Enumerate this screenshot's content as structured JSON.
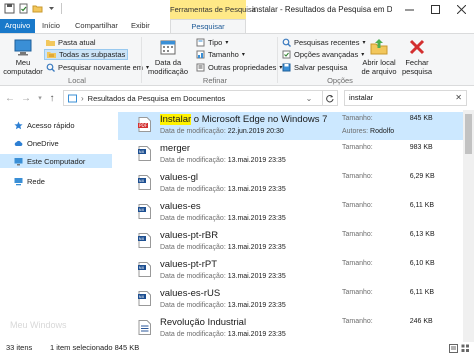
{
  "titlebar": {
    "context_tab_header": "Ferramentas de Pesquisa",
    "title": "instalar - Resultados da Pesquisa em Documentos",
    "qat_icons": [
      "save-icon",
      "properties-icon",
      "new-folder-icon",
      "customize-qat-icon"
    ]
  },
  "tabs": [
    {
      "label": "Arquivo"
    },
    {
      "label": "Início"
    },
    {
      "label": "Compartilhar"
    },
    {
      "label": "Exibir"
    },
    {
      "label": "Pesquisar"
    }
  ],
  "ribbon": {
    "local": {
      "my_computer": "Meu\ncomputador",
      "current_folder": "Pasta atual",
      "all_subfolders": "Todas as subpastas",
      "search_again": "Pesquisar novamente em",
      "group_label": "Local"
    },
    "refine": {
      "date_modified": "Data da\nmodificação",
      "kind": "Tipo",
      "size": "Tamanho",
      "other_properties": "Outras propriedades",
      "group_label": "Refinar"
    },
    "options": {
      "recent_searches": "Pesquisas recentes",
      "advanced_options": "Opções avançadas",
      "save_search": "Salvar pesquisa",
      "open_file_location": "Abrir local\nde arquivo",
      "close_search": "Fechar\npesquisa",
      "group_label": "Opções"
    }
  },
  "address": {
    "path": "Resultados da Pesquisa em Documentos",
    "search_value": "instalar"
  },
  "nav": [
    {
      "label": "Acesso rápido",
      "icon": "star-icon"
    },
    {
      "label": "OneDrive",
      "icon": "cloud-icon"
    },
    {
      "label": "Este Computador",
      "icon": "computer-icon"
    },
    {
      "label": "Rede",
      "icon": "network-icon"
    }
  ],
  "watermark": "Meu Windows",
  "files": [
    {
      "icon": "pdf-icon",
      "highlight": "Instalar",
      "rest": " o Microsoft Edge no Windows 7",
      "date_label": "Data de modificação:",
      "date": "22.jun.2019 20:30",
      "size_label": "Tamanho:",
      "size": "845 KB",
      "author_label": "Autores:",
      "author": "Rodolfo"
    },
    {
      "icon": "nx-file-icon",
      "highlight": "",
      "rest": "merger",
      "date_label": "Data de modificação:",
      "date": "13.mai.2019 23:35",
      "size_label": "Tamanho:",
      "size": "983 KB",
      "author_label": "",
      "author": ""
    },
    {
      "icon": "nx-file-icon",
      "highlight": "",
      "rest": "values-gl",
      "date_label": "Data de modificação:",
      "date": "13.mai.2019 23:35",
      "size_label": "Tamanho:",
      "size": "6,29 KB",
      "author_label": "",
      "author": ""
    },
    {
      "icon": "nx-file-icon",
      "highlight": "",
      "rest": "values-es",
      "date_label": "Data de modificação:",
      "date": "13.mai.2019 23:35",
      "size_label": "Tamanho:",
      "size": "6,11 KB",
      "author_label": "",
      "author": ""
    },
    {
      "icon": "nx-file-icon",
      "highlight": "",
      "rest": "values-pt-rBR",
      "date_label": "Data de modificação:",
      "date": "13.mai.2019 23:35",
      "size_label": "Tamanho:",
      "size": "6,13 KB",
      "author_label": "",
      "author": ""
    },
    {
      "icon": "nx-file-icon",
      "highlight": "",
      "rest": "values-pt-rPT",
      "date_label": "Data de modificação:",
      "date": "13.mai.2019 23:35",
      "size_label": "Tamanho:",
      "size": "6,10 KB",
      "author_label": "",
      "author": ""
    },
    {
      "icon": "nx-file-icon",
      "highlight": "",
      "rest": "values-es-rUS",
      "date_label": "Data de modificação:",
      "date": "13.mai.2019 23:35",
      "size_label": "Tamanho:",
      "size": "6,11 KB",
      "author_label": "",
      "author": ""
    },
    {
      "icon": "doc-icon",
      "highlight": "",
      "rest": "Revolução Industrial",
      "date_label": "Data de modificação:",
      "date": "13.mai.2019 23:35",
      "size_label": "Tamanho:",
      "size": "246 KB",
      "author_label": "",
      "author": ""
    }
  ],
  "status": {
    "count": "33 itens",
    "selected": "1 item selecionado  845 KB"
  },
  "colors": {
    "accent": "#1979ca",
    "context_tab": "#ffe987",
    "selection": "#cce8ff",
    "highlight": "#fff200"
  }
}
